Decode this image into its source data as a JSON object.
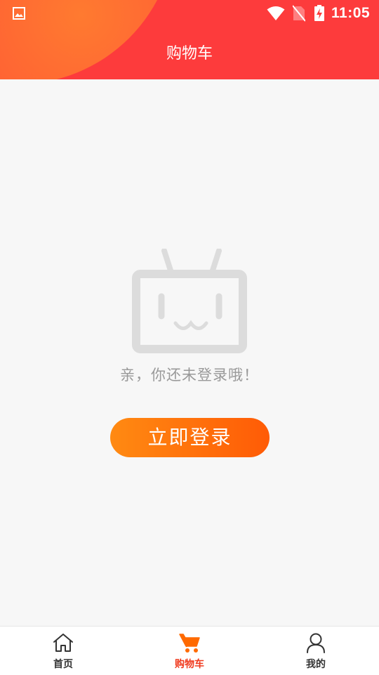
{
  "status_bar": {
    "time": "11:05",
    "icons": [
      "gallery-icon",
      "wifi-icon",
      "no-sim-icon",
      "battery-charging-icon"
    ]
  },
  "header": {
    "title": "购物车",
    "colors": {
      "primary": "#fd3b3c",
      "accent": "#ff7a30"
    }
  },
  "empty_state": {
    "illustration": "tv-face-icon",
    "message": "亲，你还未登录哦！",
    "login_button": "立即登录",
    "button_colors": [
      "#ff8a12",
      "#ff5b06"
    ]
  },
  "tab_bar": {
    "items": [
      {
        "label": "首页",
        "icon": "home-icon",
        "active": false
      },
      {
        "label": "购物车",
        "icon": "cart-icon",
        "active": true
      },
      {
        "label": "我的",
        "icon": "user-icon",
        "active": false
      }
    ],
    "active_color": "#f03a1e"
  }
}
